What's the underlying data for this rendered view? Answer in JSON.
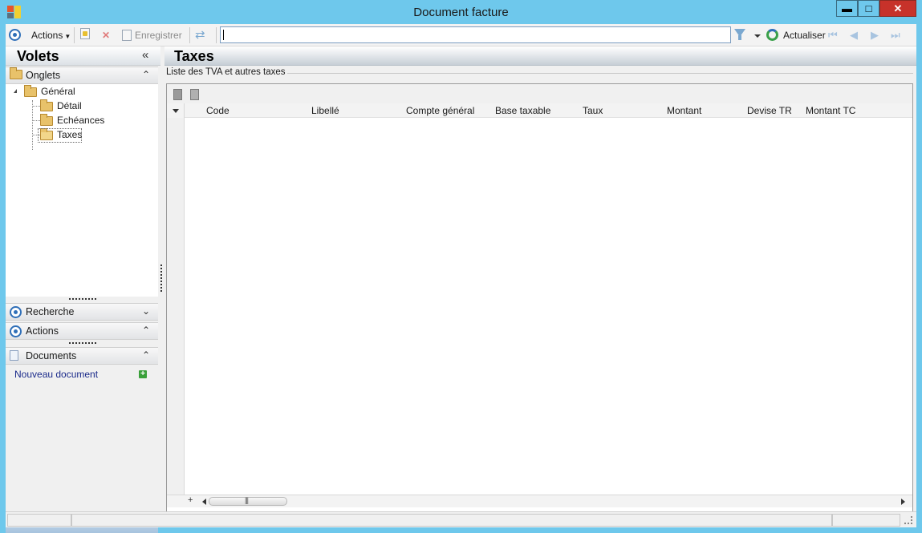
{
  "window": {
    "title": "Document facture",
    "controls": {
      "minimize": "▬",
      "maximize": "□",
      "close": "✕"
    }
  },
  "toolbar": {
    "actions_label": "Actions",
    "save_label": "Enregistrer",
    "search_value": "",
    "refresh_label": "Actualiser"
  },
  "left_panel": {
    "title": "Volets",
    "collapse_glyph": "«",
    "onglets": {
      "label": "Onglets",
      "chevron": "⌃",
      "tree": {
        "root": "Général",
        "children": [
          "Détail",
          "Echéances",
          "Taxes"
        ],
        "selected": "Taxes"
      }
    },
    "recherche": {
      "label": "Recherche",
      "chevron": "⌄"
    },
    "actions": {
      "label": "Actions",
      "chevron": "⌃"
    },
    "documents": {
      "label": "Documents",
      "chevron": "⌃",
      "link": "Nouveau document",
      "add_glyph": "+"
    }
  },
  "main": {
    "title": "Taxes",
    "group_label": "Liste des TVA et autres taxes",
    "grid": {
      "columns": [
        "Code",
        "Libellé",
        "Compte général",
        "Base taxable",
        "Taux",
        "Montant",
        "Devise TR",
        "Montant TC"
      ],
      "rows": [],
      "add_row_glyph": "+"
    }
  },
  "colors": {
    "window_frame": "#6ec8ec",
    "close_button": "#c7322a",
    "accent_blue": "#2f6fb8",
    "link_text": "#1a2a8a",
    "add_green": "#3aa03a"
  }
}
